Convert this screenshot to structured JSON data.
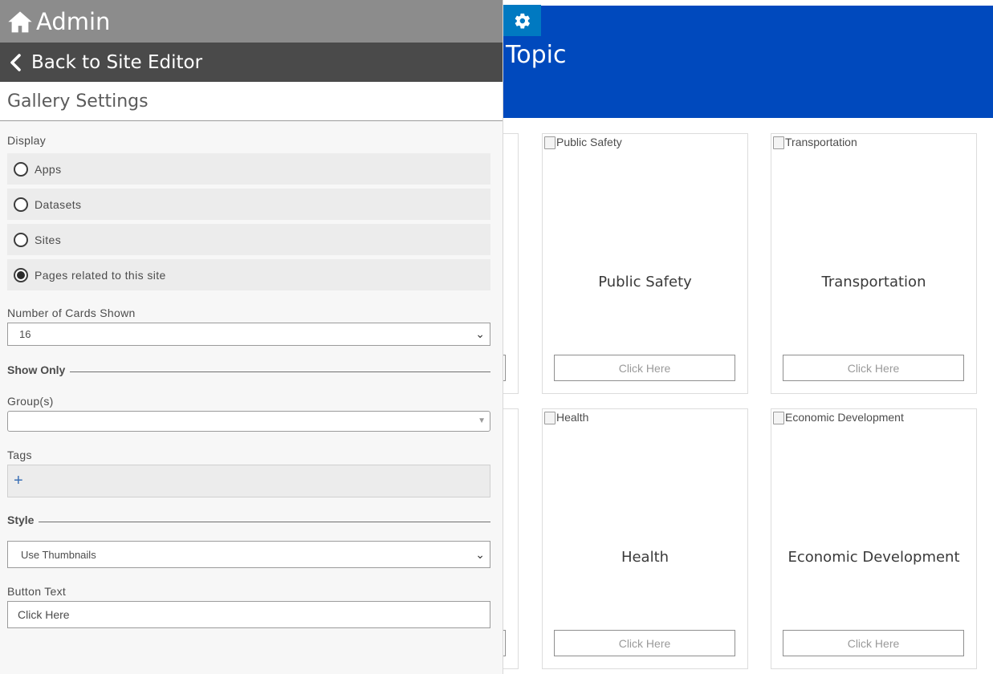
{
  "admin": {
    "title": "Admin",
    "back_label": "Back to Site Editor",
    "settings_title": "Gallery Settings",
    "display_label": "Display",
    "display_options": [
      {
        "label": "Apps",
        "checked": false
      },
      {
        "label": "Datasets",
        "checked": false
      },
      {
        "label": "Sites",
        "checked": false
      },
      {
        "label": "Pages related to this site",
        "checked": true
      }
    ],
    "cards_label": "Number of Cards Shown",
    "cards_value": "16",
    "show_only_label": "Show Only",
    "groups_label": "Group(s)",
    "groups_value": "",
    "tags_label": "Tags",
    "tags_add": "+",
    "style_label": "Style",
    "style_value": "Use Thumbnails",
    "button_text_label": "Button Text",
    "button_text_value": "Click Here"
  },
  "preview": {
    "banner_title": "Topic",
    "colors": {
      "banner": "#0049bd",
      "gear_button": "#0079c1"
    },
    "cards": [
      {
        "alt": "Public Safety",
        "title": "Public Safety",
        "button": "Click Here"
      },
      {
        "alt": "Transportation",
        "title": "Transportation",
        "button": "Click Here"
      },
      {
        "alt": "Health",
        "title": "Health",
        "button": "Click Here"
      },
      {
        "alt": "Economic Development",
        "title": "Economic Development",
        "button": "Click Here"
      }
    ]
  }
}
